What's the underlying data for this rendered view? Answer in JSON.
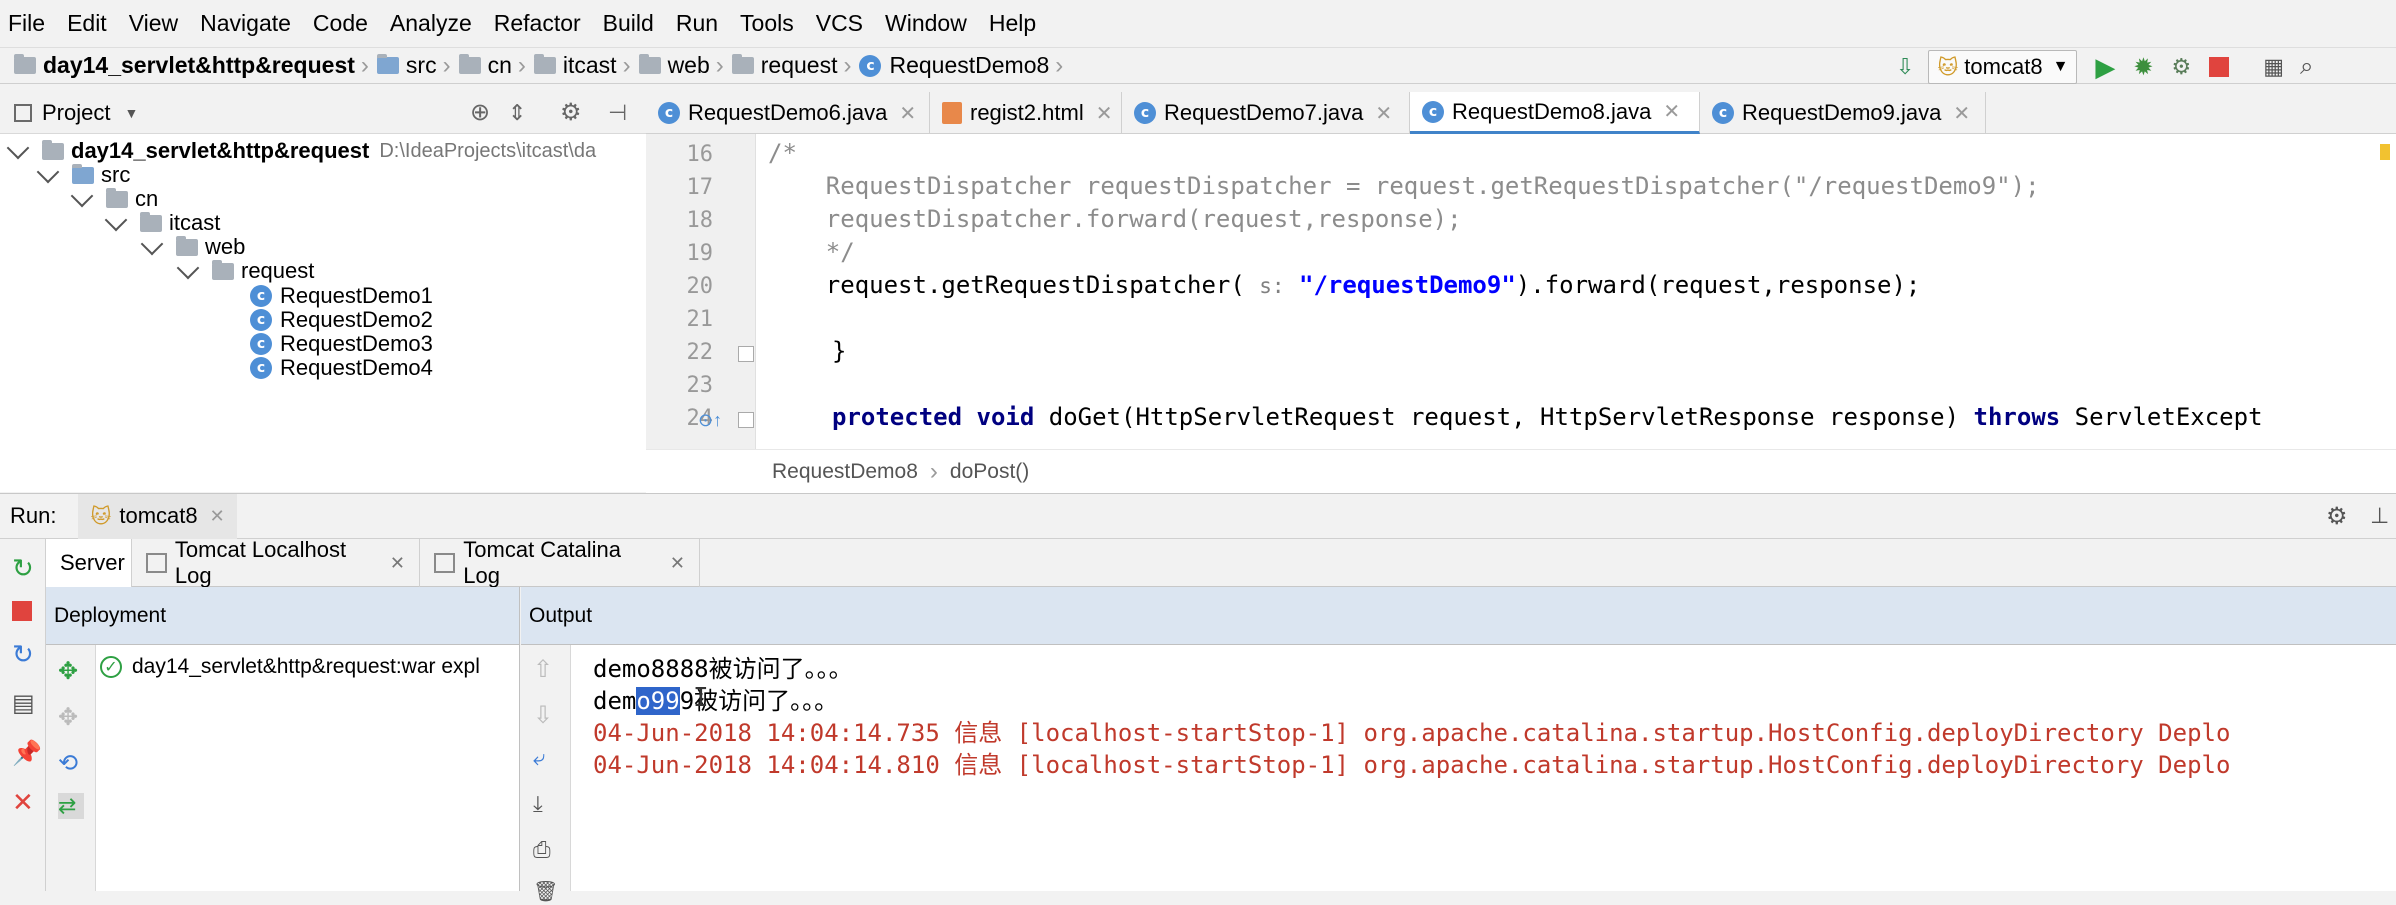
{
  "menu": [
    "File",
    "Edit",
    "View",
    "Navigate",
    "Code",
    "Analyze",
    "Refactor",
    "Build",
    "Run",
    "Tools",
    "VCS",
    "Window",
    "Help"
  ],
  "nav": {
    "crumbs": [
      "day14_servlet&http&request",
      "src",
      "cn",
      "itcast",
      "web",
      "request",
      "RequestDemo8"
    ],
    "run_config": "tomcat8"
  },
  "project_panel": {
    "title": "Project",
    "tree": [
      {
        "label": "day14_servlet&http&request",
        "path": "D:\\IdeaProjects\\itcast\\da",
        "type": "module"
      },
      {
        "label": "src",
        "type": "folder"
      },
      {
        "label": "cn",
        "type": "folder"
      },
      {
        "label": "itcast",
        "type": "folder"
      },
      {
        "label": "web",
        "type": "folder"
      },
      {
        "label": "request",
        "type": "folder"
      },
      {
        "label": "RequestDemo1",
        "type": "class"
      },
      {
        "label": "RequestDemo2",
        "type": "class"
      },
      {
        "label": "RequestDemo3",
        "type": "class"
      },
      {
        "label": "RequestDemo4",
        "type": "class"
      }
    ]
  },
  "editor_tabs": [
    {
      "label": "RequestDemo6.java",
      "type": "class"
    },
    {
      "label": "regist2.html",
      "type": "html"
    },
    {
      "label": "RequestDemo7.java",
      "type": "class"
    },
    {
      "label": "RequestDemo8.java",
      "type": "class",
      "active": true
    },
    {
      "label": "RequestDemo9.java",
      "type": "class"
    }
  ],
  "code": {
    "line_numbers": [
      "16",
      "17",
      "18",
      "19",
      "20",
      "21",
      "22",
      "23",
      "24"
    ],
    "l16": "/*",
    "l17": "    RequestDispatcher requestDispatcher = request.getRequestDispatcher(\"/requestDemo9\");",
    "l18": "    requestDispatcher.forward(request,response);",
    "l19": "    */",
    "l20_a": "    request.getRequestDispatcher(",
    "l20_hint": "s:",
    "l20_str": "\"/requestDemo9\"",
    "l20_b": ").forward(request,response);",
    "l22": "}",
    "l24_kw1": "protected",
    "l24_kw2": "void",
    "l24_a": "doGet(HttpServletRequest request, HttpServletResponse response)",
    "l24_kw3": "throws",
    "l24_b": "ServletExcept"
  },
  "editor_breadcrumb": [
    "RequestDemo8",
    "doPost()"
  ],
  "run": {
    "label": "Run:",
    "config": "tomcat8",
    "tabs": [
      "Server",
      "Tomcat Localhost Log",
      "Tomcat Catalina Log"
    ],
    "deployment_header": "Deployment",
    "output_header": "Output",
    "deployment_item": "day14_servlet&http&request:war expl",
    "output": {
      "line1": "demo8888被访问了。。。",
      "line2_pre": "dem",
      "line2_sel": "o99",
      "line2_post": "9被访问了。。。",
      "line3": "04-Jun-2018 14:04:14.735 信息 [localhost-startStop-1] org.apache.catalina.startup.HostConfig.deployDirectory Deplo",
      "line4": "04-Jun-2018 14:04:14.810 信息 [localhost-startStop-1] org.apache.catalina.startup.HostConfig.deployDirectory Deplo"
    }
  },
  "colors": {
    "accent": "#4083c9",
    "log_red": "#c0392b",
    "selection": "#2f65ca",
    "run_green": "#2ea043",
    "stop_red": "#e0443e"
  }
}
